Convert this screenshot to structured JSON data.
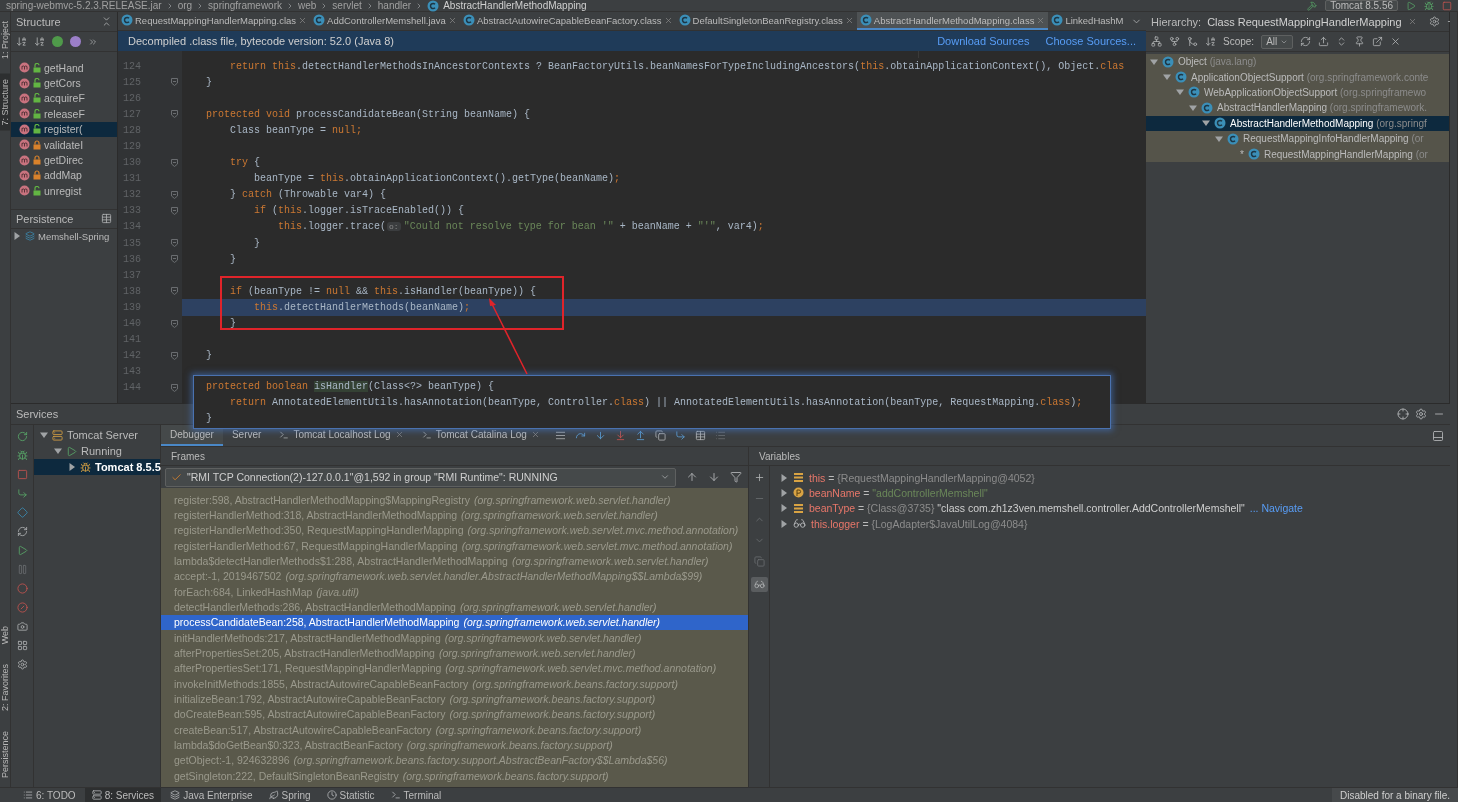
{
  "breadcrumb": {
    "items": [
      "spring-webmvc-5.2.3.RELEASE.jar",
      "org",
      "springframework",
      "web",
      "servlet",
      "handler",
      "AbstractHandlerMethodMapping"
    ],
    "run_config": "Tomcat 8.5.56"
  },
  "left_strip": {
    "top_tabs": [
      {
        "label": "1: Project",
        "selected": false
      },
      {
        "label": "7: Structure",
        "selected": true
      }
    ],
    "bottom_tabs": [
      {
        "label": "Web",
        "selected": false
      },
      {
        "label": "2: Favorites",
        "selected": false
      },
      {
        "label": "Persistence",
        "selected": false
      }
    ]
  },
  "structure": {
    "title": "Structure",
    "items": [
      {
        "label": "getHand",
        "locked": false,
        "selected": false
      },
      {
        "label": "getCors",
        "locked": false,
        "selected": false
      },
      {
        "label": "acquireF",
        "locked": false,
        "selected": false
      },
      {
        "label": "releaseF",
        "locked": false,
        "selected": false
      },
      {
        "label": "register(",
        "locked": false,
        "selected": true
      },
      {
        "label": "validateI",
        "locked": true,
        "selected": false
      },
      {
        "label": "getDirec",
        "locked": true,
        "selected": false
      },
      {
        "label": "addMap",
        "locked": true,
        "selected": false
      },
      {
        "label": "unregist",
        "locked": false,
        "selected": false
      }
    ]
  },
  "persistence": {
    "title": "Persistence",
    "item": {
      "label": "Memshell-Spring",
      "expanded": false
    }
  },
  "editor": {
    "tabs": [
      {
        "label": "RequestMappingHandlerMapping.clas",
        "selected": false
      },
      {
        "label": "AddControllerMemshell.java",
        "selected": false
      },
      {
        "label": "AbstractAutowireCapableBeanFactory.class",
        "selected": false
      },
      {
        "label": "DefaultSingletonBeanRegistry.class",
        "selected": false
      },
      {
        "label": "AbstractHandlerMethodMapping.class",
        "selected": true
      },
      {
        "label": "LinkedHashM",
        "selected": false
      }
    ],
    "notification": {
      "text": "Decompiled .class file, bytecode version: 52.0 (Java 8)",
      "actions": [
        "Download Sources",
        "Choose Sources..."
      ]
    },
    "lines": [
      {
        "number": "124",
        "fold": false,
        "current": false,
        "tokens": [
          {
            "kind": "kw",
            "text": "        return this"
          },
          {
            "kind": "plain",
            "text": ".detectHandlerMethodsInAncestorContexts ? BeanFactoryUtils.beanNamesForTypeIncludingAncestors("
          },
          {
            "kind": "kw",
            "text": "this"
          },
          {
            "kind": "plain",
            "text": ".obtainApplicationContext(), Object."
          },
          {
            "kind": "kw",
            "text": "clas"
          }
        ]
      },
      {
        "number": "125",
        "fold": true,
        "current": false,
        "tokens": [
          {
            "kind": "plain",
            "text": "    }"
          }
        ]
      },
      {
        "number": "126",
        "fold": false,
        "current": false
      },
      {
        "number": "127",
        "fold": true,
        "current": false,
        "tokens": [
          {
            "kind": "kw",
            "text": "    protected void"
          },
          {
            "kind": "plain",
            "text": " processCandidateBean(String beanName) {"
          }
        ]
      },
      {
        "number": "128",
        "fold": false,
        "current": false,
        "tokens": [
          {
            "kind": "plain",
            "text": "        Class beanType = "
          },
          {
            "kind": "kw",
            "text": "null;"
          }
        ]
      },
      {
        "number": "129",
        "fold": false,
        "current": false
      },
      {
        "number": "130",
        "fold": true,
        "current": false,
        "tokens": [
          {
            "kind": "kw",
            "text": "        try"
          },
          {
            "kind": "plain",
            "text": " {"
          }
        ]
      },
      {
        "number": "131",
        "fold": false,
        "current": false,
        "tokens": [
          {
            "kind": "plain",
            "text": "            beanType = "
          },
          {
            "kind": "kw",
            "text": "this"
          },
          {
            "kind": "plain",
            "text": ".obtainApplicationContext().getType(beanName)"
          },
          {
            "kind": "kw",
            "text": ";"
          }
        ]
      },
      {
        "number": "132",
        "fold": true,
        "current": false,
        "tokens": [
          {
            "kind": "plain",
            "text": "        } "
          },
          {
            "kind": "kw",
            "text": "catch"
          },
          {
            "kind": "plain",
            "text": " (Throwable var4) {"
          }
        ]
      },
      {
        "number": "133",
        "fold": true,
        "current": false,
        "tokens": [
          {
            "kind": "kw",
            "text": "            if"
          },
          {
            "kind": "plain",
            "text": " ("
          },
          {
            "kind": "kw",
            "text": "this"
          },
          {
            "kind": "plain",
            "text": ".logger.isTraceEnabled()) {"
          }
        ]
      },
      {
        "number": "134",
        "fold": false,
        "current": false,
        "tokens": [
          {
            "kind": "kw",
            "text": "                this"
          },
          {
            "kind": "plain",
            "text": ".logger.trace("
          },
          {
            "kind": "hint",
            "text": "o:"
          },
          {
            "kind": "str",
            "text": "\"Could not resolve type for bean '\""
          },
          {
            "kind": "plain",
            "text": " + beanName + "
          },
          {
            "kind": "str",
            "text": "\"'\""
          },
          {
            "kind": "plain",
            "text": ", var4)"
          },
          {
            "kind": "kw",
            "text": ";"
          }
        ]
      },
      {
        "number": "135",
        "fold": true,
        "current": false,
        "tokens": [
          {
            "kind": "plain",
            "text": "            }"
          }
        ]
      },
      {
        "number": "136",
        "fold": true,
        "current": false,
        "tokens": [
          {
            "kind": "plain",
            "text": "        }"
          }
        ]
      },
      {
        "number": "137",
        "fold": false,
        "current": false
      },
      {
        "number": "138",
        "fold": true,
        "current": false,
        "tokens": [
          {
            "kind": "kw",
            "text": "        if"
          },
          {
            "kind": "plain",
            "text": " (beanType != "
          },
          {
            "kind": "kw",
            "text": "null"
          },
          {
            "kind": "plain",
            "text": " && "
          },
          {
            "kind": "kw",
            "text": "this"
          },
          {
            "kind": "plain",
            "text": ".isHandler(beanType)) {"
          }
        ]
      },
      {
        "number": "139",
        "fold": false,
        "current": true,
        "tokens": [
          {
            "kind": "kw",
            "text": "            this"
          },
          {
            "kind": "plain",
            "text": ".detectHandlerMethods(beanName)"
          },
          {
            "kind": "kw",
            "text": ";"
          }
        ]
      },
      {
        "number": "140",
        "fold": true,
        "current": false,
        "tokens": [
          {
            "kind": "plain",
            "text": "        }"
          }
        ]
      },
      {
        "number": "141",
        "fold": false,
        "current": false
      },
      {
        "number": "142",
        "fold": true,
        "current": false,
        "tokens": [
          {
            "kind": "plain",
            "text": "    }"
          }
        ]
      },
      {
        "number": "143",
        "fold": false,
        "current": false
      },
      {
        "number": "144",
        "fold": true,
        "current": false
      }
    ]
  },
  "popup": {
    "lines": [
      {
        "tokens": [
          {
            "kind": "kw",
            "text": "protected boolean "
          },
          {
            "kind": "usage",
            "text": "isHandler"
          },
          {
            "kind": "plain",
            "text": "(Class<?> beanType) {"
          }
        ]
      },
      {
        "tokens": [
          {
            "kind": "kw",
            "text": "    return"
          },
          {
            "kind": "plain",
            "text": " AnnotatedElementUtils.hasAnnotation(beanType, Controller."
          },
          {
            "kind": "kw",
            "text": "class"
          },
          {
            "kind": "plain",
            "text": ") || AnnotatedElementUtils.hasAnnotation(beanType, RequestMapping."
          },
          {
            "kind": "kw",
            "text": "class"
          },
          {
            "kind": "plain",
            "text": ")"
          },
          {
            "kind": "kw",
            "text": ";"
          }
        ]
      },
      {
        "tokens": [
          {
            "kind": "plain",
            "text": "}"
          }
        ]
      }
    ]
  },
  "hierarchy": {
    "title": "Hierarchy:",
    "tab": "Class RequestMappingHandlerMapping",
    "scope_label": "Scope:",
    "scope": "All",
    "tree": [
      {
        "label": "Object",
        "package": "(java.lang)",
        "expanded": true,
        "selected": false,
        "children": [
          {
            "label": "ApplicationObjectSupport",
            "package": "(org.springframework.conte",
            "expanded": true,
            "selected": false,
            "children": [
              {
                "label": "WebApplicationObjectSupport",
                "package": "(org.springframewo",
                "expanded": true,
                "selected": false,
                "children": [
                  {
                    "label": "AbstractHandlerMapping",
                    "package": "(org.springframework.",
                    "expanded": true,
                    "selected": false,
                    "children": [
                      {
                        "label": "AbstractHandlerMethodMapping",
                        "package": "(org.springf",
                        "expanded": true,
                        "selected": true,
                        "children": [
                          {
                            "label": "RequestMappingInfoHandlerMapping",
                            "package": "(or",
                            "expanded": true,
                            "selected": false,
                            "children": [
                              {
                                "marker": "*",
                                "label": "RequestMappingHandlerMapping",
                                "package": "(or",
                                "selected": false
                              }
                            ]
                          }
                        ]
                      }
                    ]
                  }
                ]
              }
            ]
          }
        ]
      }
    ]
  },
  "services": {
    "title": "Services",
    "tree": [
      {
        "label": "Tomcat Server",
        "expanded": true,
        "selected": false,
        "children": [
          {
            "label": "Running",
            "expanded": true,
            "selected": false,
            "children": [
              {
                "label": "Tomcat 8.5.5",
                "expanded": false,
                "selected": true
              }
            ]
          }
        ]
      }
    ],
    "tabs": [
      {
        "label": "Debugger",
        "selected": true,
        "closable": false
      },
      {
        "label": "Server",
        "selected": false,
        "closable": false
      },
      {
        "label": "Tomcat Localhost Log",
        "selected": false,
        "closable": true
      },
      {
        "label": "Tomcat Catalina Log",
        "selected": false,
        "closable": true
      }
    ],
    "frames": {
      "title": "Frames",
      "thread": "\"RMI TCP Connection(2)-127.0.0.1\"@1,592 in group \"RMI Runtime\": RUNNING",
      "items": [
        {
          "method": "register:598, AbstractHandlerMethodMapping$MappingRegistry",
          "package": "(org.springframework.web.servlet.handler)",
          "selected": false
        },
        {
          "method": "registerHandlerMethod:318, AbstractHandlerMethodMapping",
          "package": "(org.springframework.web.servlet.handler)",
          "selected": false
        },
        {
          "method": "registerHandlerMethod:350, RequestMappingHandlerMapping",
          "package": "(org.springframework.web.servlet.mvc.method.annotation)",
          "selected": false
        },
        {
          "method": "registerHandlerMethod:67, RequestMappingHandlerMapping",
          "package": "(org.springframework.web.servlet.mvc.method.annotation)",
          "selected": false
        },
        {
          "method": "lambda$detectHandlerMethods$1:288, AbstractHandlerMethodMapping",
          "package": "(org.springframework.web.servlet.handler)",
          "selected": false
        },
        {
          "method": "accept:-1, 2019467502",
          "package": "(org.springframework.web.servlet.handler.AbstractHandlerMethodMapping$$Lambda$99)",
          "selected": false
        },
        {
          "method": "forEach:684, LinkedHashMap",
          "package": "(java.util)",
          "selected": false
        },
        {
          "method": "detectHandlerMethods:286, AbstractHandlerMethodMapping",
          "package": "(org.springframework.web.servlet.handler)",
          "selected": false
        },
        {
          "method": "processCandidateBean:258, AbstractHandlerMethodMapping",
          "package": "(org.springframework.web.servlet.handler)",
          "selected": true
        },
        {
          "method": "initHandlerMethods:217, AbstractHandlerMethodMapping",
          "package": "(org.springframework.web.servlet.handler)",
          "selected": false
        },
        {
          "method": "afterPropertiesSet:205, AbstractHandlerMethodMapping",
          "package": "(org.springframework.web.servlet.handler)",
          "selected": false
        },
        {
          "method": "afterPropertiesSet:171, RequestMappingHandlerMapping",
          "package": "(org.springframework.web.servlet.mvc.method.annotation)",
          "selected": false
        },
        {
          "method": "invokeInitMethods:1855, AbstractAutowireCapableBeanFactory",
          "package": "(org.springframework.beans.factory.support)",
          "selected": false
        },
        {
          "method": "initializeBean:1792, AbstractAutowireCapableBeanFactory",
          "package": "(org.springframework.beans.factory.support)",
          "selected": false
        },
        {
          "method": "doCreateBean:595, AbstractAutowireCapableBeanFactory",
          "package": "(org.springframework.beans.factory.support)",
          "selected": false
        },
        {
          "method": "createBean:517, AbstractAutowireCapableBeanFactory",
          "package": "(org.springframework.beans.factory.support)",
          "selected": false
        },
        {
          "method": "lambda$doGetBean$0:323, AbstractBeanFactory",
          "package": "(org.springframework.beans.factory.support)",
          "selected": false
        },
        {
          "method": "getObject:-1, 924632896",
          "package": "(org.springframework.beans.factory.support.AbstractBeanFactory$$Lambda$56)",
          "selected": false
        },
        {
          "method": "getSingleton:222, DefaultSingletonBeanRegistry",
          "package": "(org.springframework.beans.factory.support)",
          "selected": false
        }
      ]
    },
    "variables": {
      "title": "Variables",
      "items": [
        {
          "kind": "field",
          "name": "this",
          "operator": "=",
          "value": "{RequestMappingHandlerMapping@4052}"
        },
        {
          "kind": "param",
          "name": "beanName",
          "operator": "=",
          "string": "\"addControllerMemshell\""
        },
        {
          "kind": "field",
          "name": "beanType",
          "operator": "=",
          "value": "{Class@3735}",
          "description": "\"class com.zh1z3ven.memshell.controller.AddControllerMemshell\"",
          "link": "... Navigate"
        },
        {
          "kind": "watch",
          "name": "this.logger",
          "operator": "=",
          "value": "{LogAdapter$JavaUtilLog@4084}"
        }
      ]
    }
  },
  "status_bar": {
    "tabs": [
      {
        "label": "6: TODO",
        "selected": false
      },
      {
        "label": "8: Services",
        "selected": true
      },
      {
        "label": "Java Enterprise",
        "selected": false
      },
      {
        "label": "Spring",
        "selected": false
      },
      {
        "label": "Statistic",
        "selected": false
      },
      {
        "label": "Terminal",
        "selected": false
      }
    ],
    "message": "Disabled for a binary file."
  }
}
